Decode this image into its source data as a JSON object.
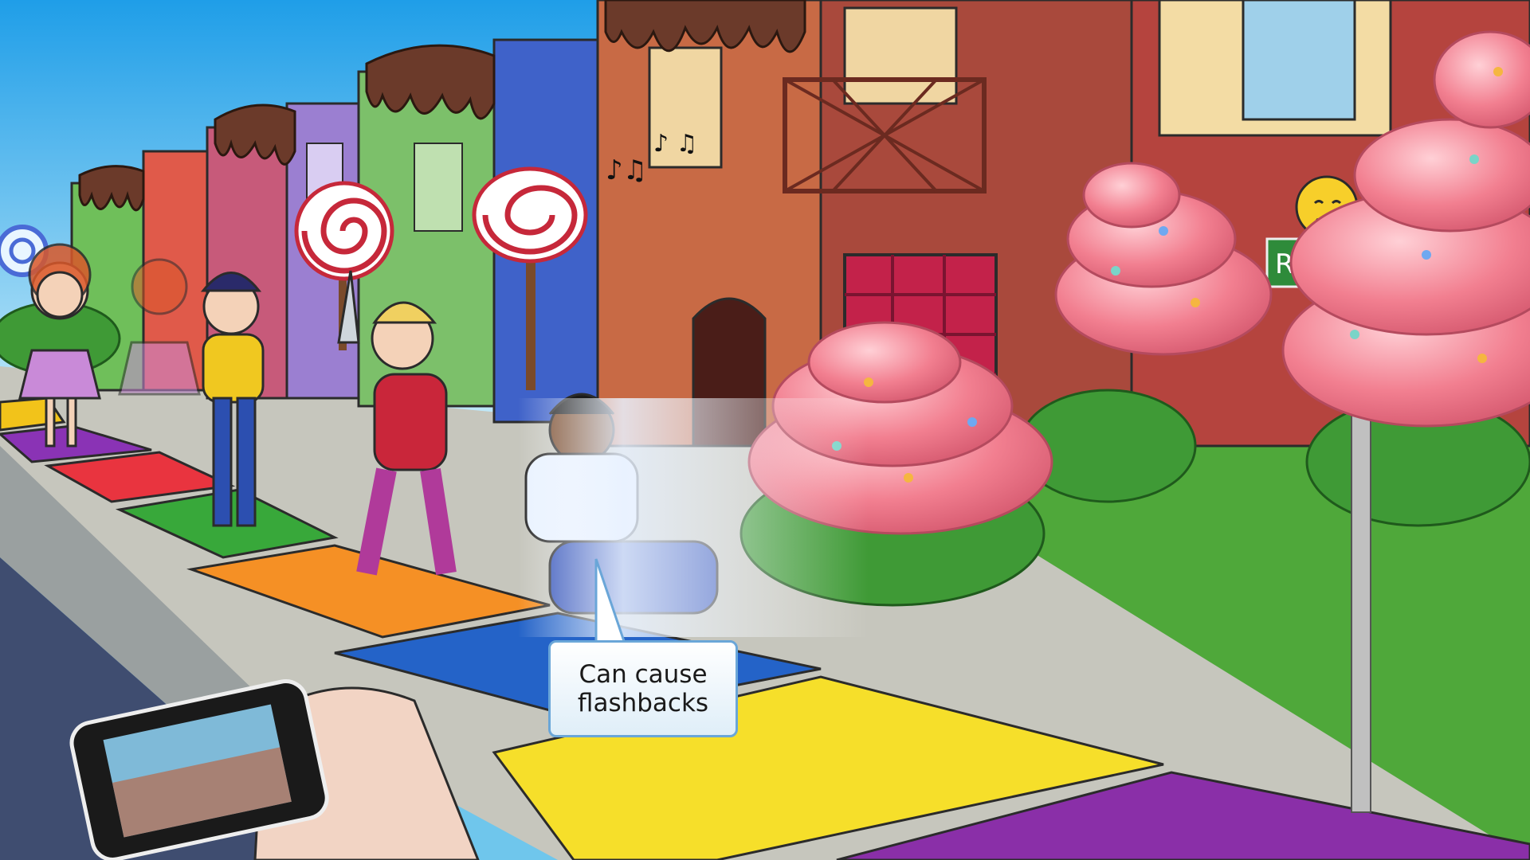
{
  "callout": {
    "line1": "Can cause",
    "line2": "flashbacks"
  },
  "street_sign": {
    "text": "RS"
  },
  "music_notes_icon": "music-notes-icon",
  "colors": {
    "sky": "#4fb3ea",
    "callout_border": "#6aa6d8",
    "frosting_pink": "#f07a8d",
    "chocolate_drip": "#6b3a2a"
  }
}
